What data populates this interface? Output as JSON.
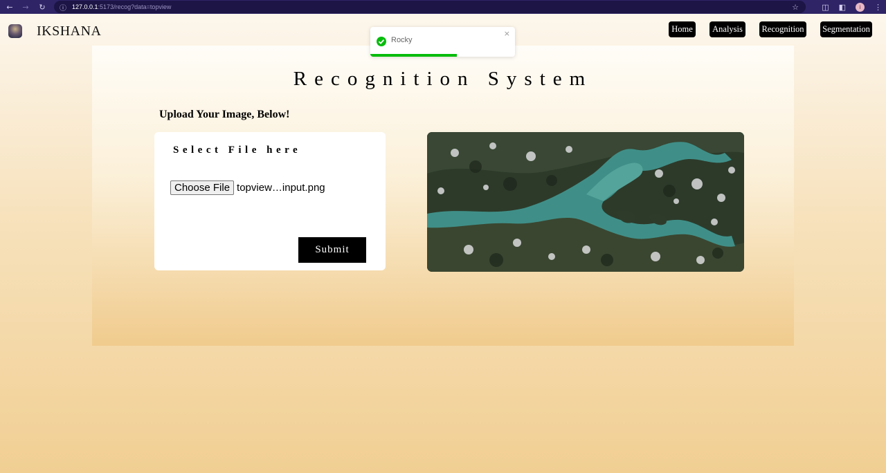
{
  "browser": {
    "url_host": "127.0.0.1",
    "url_rest": ":5173/recog?data=topview"
  },
  "header": {
    "brand": "IKSHANA",
    "nav": [
      "Home",
      "Analysis",
      "Recognition",
      "Segmentation"
    ]
  },
  "toast": {
    "message": "Rocky",
    "progress": 0.6
  },
  "main": {
    "title": "Recognition System",
    "upload_label": "Upload Your Image, Below!",
    "card_title": "Select File here",
    "choose_file_label": "Choose File",
    "file_name": "topview…input.png",
    "submit_label": "Submit"
  },
  "colors": {
    "chrome": "#2f2466",
    "toast_success": "#07bc0c",
    "button": "#000000"
  }
}
